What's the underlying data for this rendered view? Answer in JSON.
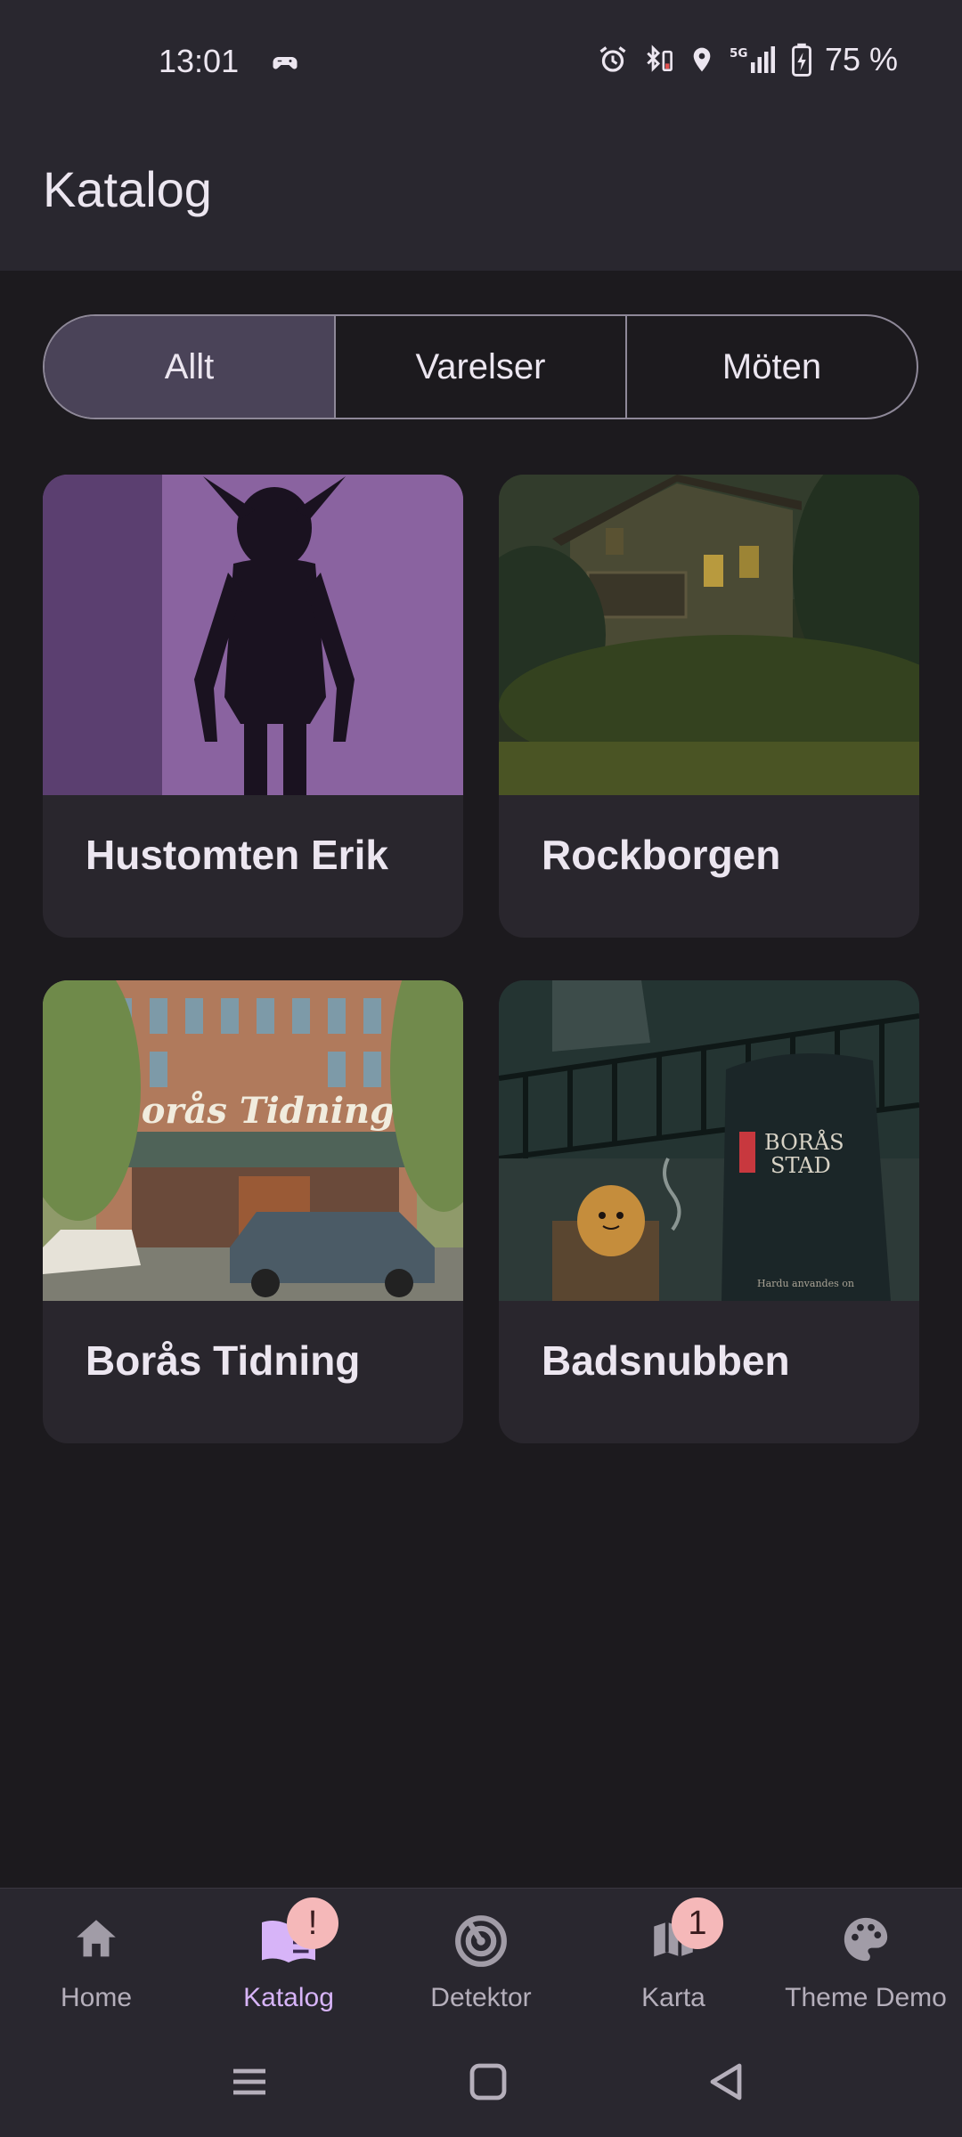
{
  "status": {
    "time": "13:01",
    "battery": "75 %"
  },
  "app": {
    "title": "Katalog"
  },
  "filters": {
    "options": [
      "Allt",
      "Varelser",
      "Möten"
    ],
    "selected": "Allt"
  },
  "cards": [
    {
      "title": "Hustomten Erik"
    },
    {
      "title": "Rockborgen"
    },
    {
      "title": "Borås Tidning",
      "sign": "Borås Tidning"
    },
    {
      "title": "Badsnubben",
      "sign_1": "BORÅS",
      "sign_2": "STAD",
      "note": "Hardu anvandes on"
    }
  ],
  "nav": {
    "items": [
      {
        "label": "Home",
        "icon": "home-icon"
      },
      {
        "label": "Katalog",
        "icon": "book-icon",
        "badge": "!"
      },
      {
        "label": "Detektor",
        "icon": "radar-icon"
      },
      {
        "label": "Karta",
        "icon": "map-icon",
        "badge": "1"
      },
      {
        "label": "Theme Demo",
        "icon": "palette-icon"
      }
    ],
    "active": "Katalog"
  },
  "colors": {
    "accent": "#d7b4f8",
    "badge": "#f5b8b9",
    "surface": "#29272f",
    "background": "#1c1a1e"
  }
}
